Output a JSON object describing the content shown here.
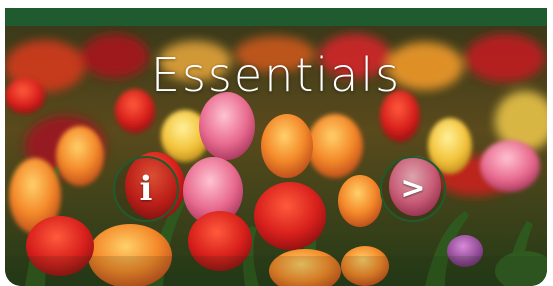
{
  "card": {
    "title": "Essentials",
    "accent_color": "#1f5b2e",
    "background_image": "tulip-field-photo"
  },
  "buttons": {
    "info": {
      "glyph": "i",
      "icon": "info-icon"
    },
    "next": {
      "glyph": ">",
      "icon": "chevron-right-icon"
    }
  }
}
